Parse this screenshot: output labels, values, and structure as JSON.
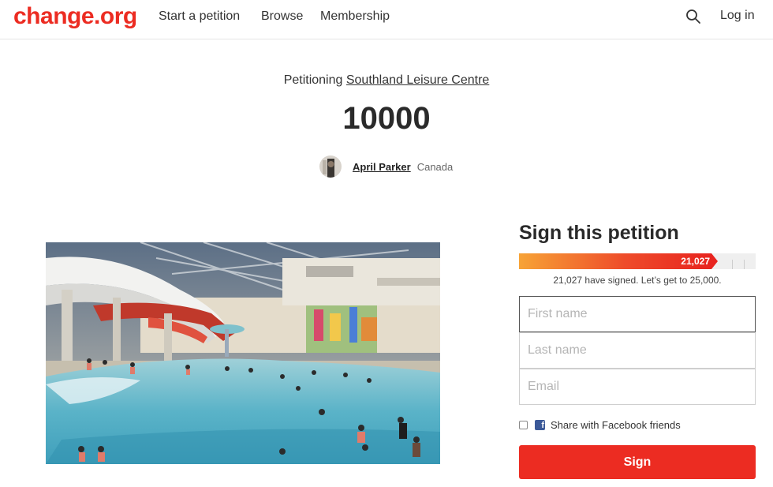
{
  "brand": {
    "logo": "change.org",
    "accent": "#ec2c22"
  },
  "nav": {
    "items": [
      "Start a petition",
      "Browse",
      "Membership"
    ],
    "login": "Log in",
    "search_icon": "search-icon"
  },
  "petition": {
    "petitioning_prefix": "Petitioning",
    "target": "Southland Leisure Centre",
    "title": "10000",
    "author": "April Parker",
    "country": "Canada"
  },
  "sign": {
    "heading": "Sign this petition",
    "count_label": "21,027",
    "progress": 0.8411,
    "signed_text": "21,027 have signed. Let’s get to 25,000.",
    "first_name_placeholder": "First name",
    "last_name_placeholder": "Last name",
    "email_placeholder": "Email",
    "facebook_label": "Share with Facebook friends",
    "button_label": "Sign"
  }
}
